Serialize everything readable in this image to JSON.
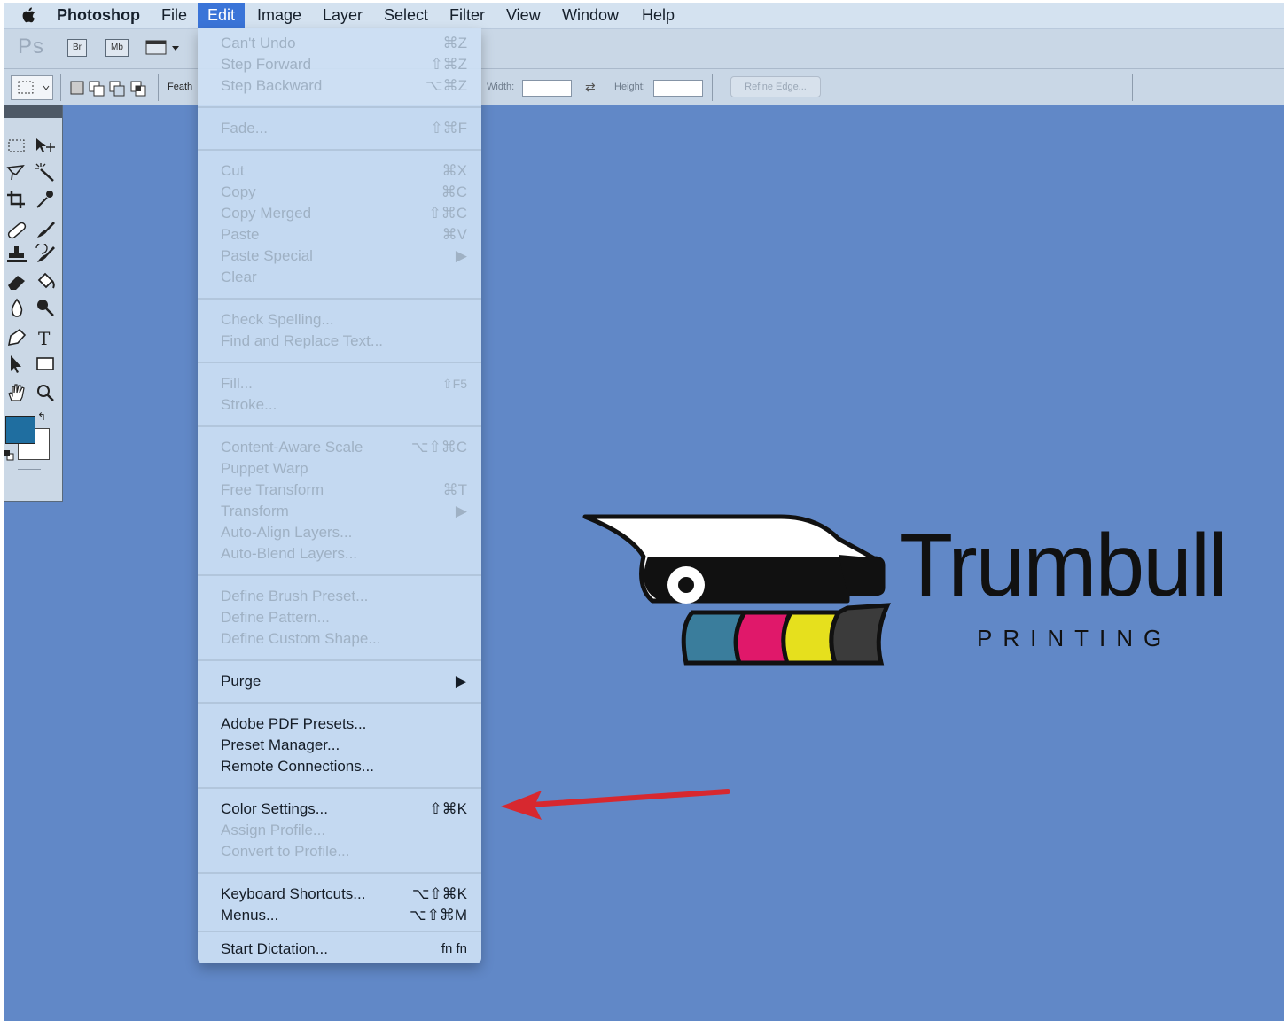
{
  "menubar": {
    "app_name": "Photoshop",
    "items": [
      "File",
      "Edit",
      "Image",
      "Layer",
      "Select",
      "Filter",
      "View",
      "Window",
      "Help"
    ],
    "active_item": "Edit"
  },
  "appbar": {
    "logo": "Ps",
    "br_label": "Br",
    "mb_label": "Mb"
  },
  "options": {
    "feather_label": "Feath",
    "width_label": "Width:",
    "height_label": "Height:",
    "refine_edge_label": "Refine Edge..."
  },
  "toolbar": {
    "foreground_color": "#1f6ea0",
    "background_color": "#ffffff"
  },
  "edit_menu": {
    "items": [
      {
        "label": "Can't Undo",
        "shortcut": "⌘Z",
        "enabled": false
      },
      {
        "label": "Step Forward",
        "shortcut": "⇧⌘Z",
        "enabled": false
      },
      {
        "label": "Step Backward",
        "shortcut": "⌥⌘Z",
        "enabled": false
      },
      {
        "label": "Fade...",
        "shortcut": "⇧⌘F",
        "enabled": false
      },
      {
        "label": "Cut",
        "shortcut": "⌘X",
        "enabled": false
      },
      {
        "label": "Copy",
        "shortcut": "⌘C",
        "enabled": false
      },
      {
        "label": "Copy Merged",
        "shortcut": "⇧⌘C",
        "enabled": false
      },
      {
        "label": "Paste",
        "shortcut": "⌘V",
        "enabled": false
      },
      {
        "label": "Paste Special",
        "shortcut": "▶",
        "enabled": false
      },
      {
        "label": "Clear",
        "shortcut": "",
        "enabled": false
      },
      {
        "label": "Check Spelling...",
        "shortcut": "",
        "enabled": false
      },
      {
        "label": "Find and Replace Text...",
        "shortcut": "",
        "enabled": false
      },
      {
        "label": "Fill...",
        "shortcut": "⇧F5",
        "enabled": false
      },
      {
        "label": "Stroke...",
        "shortcut": "",
        "enabled": false
      },
      {
        "label": "Content-Aware Scale",
        "shortcut": "⌥⇧⌘C",
        "enabled": false
      },
      {
        "label": "Puppet Warp",
        "shortcut": "",
        "enabled": false
      },
      {
        "label": "Free Transform",
        "shortcut": "⌘T",
        "enabled": false
      },
      {
        "label": "Transform",
        "shortcut": "▶",
        "enabled": false
      },
      {
        "label": "Auto-Align Layers...",
        "shortcut": "",
        "enabled": false
      },
      {
        "label": "Auto-Blend Layers...",
        "shortcut": "",
        "enabled": false
      },
      {
        "label": "Define Brush Preset...",
        "shortcut": "",
        "enabled": false
      },
      {
        "label": "Define Pattern...",
        "shortcut": "",
        "enabled": false
      },
      {
        "label": "Define Custom Shape...",
        "shortcut": "",
        "enabled": false
      },
      {
        "label": "Purge",
        "shortcut": "▶",
        "enabled": true
      },
      {
        "label": "Adobe PDF Presets...",
        "shortcut": "",
        "enabled": true
      },
      {
        "label": "Preset Manager...",
        "shortcut": "",
        "enabled": true
      },
      {
        "label": "Remote Connections...",
        "shortcut": "",
        "enabled": true
      },
      {
        "label": "Color Settings...",
        "shortcut": "⇧⌘K",
        "enabled": true
      },
      {
        "label": "Assign Profile...",
        "shortcut": "",
        "enabled": false
      },
      {
        "label": "Convert to Profile...",
        "shortcut": "",
        "enabled": false
      },
      {
        "label": "Keyboard Shortcuts...",
        "shortcut": "⌥⇧⌘K",
        "enabled": true
      },
      {
        "label": "Menus...",
        "shortcut": "⌥⇧⌘M",
        "enabled": true
      },
      {
        "label": "Start Dictation...",
        "shortcut": "fn fn",
        "enabled": true
      }
    ]
  },
  "logo": {
    "name": "Trumbull",
    "tagline": "PRINTING",
    "colors": [
      "#3a7d9c",
      "#e0186a",
      "#e6e01d",
      "#3b3b3b"
    ]
  },
  "annotation": {
    "arrow_color": "#d7282f"
  }
}
